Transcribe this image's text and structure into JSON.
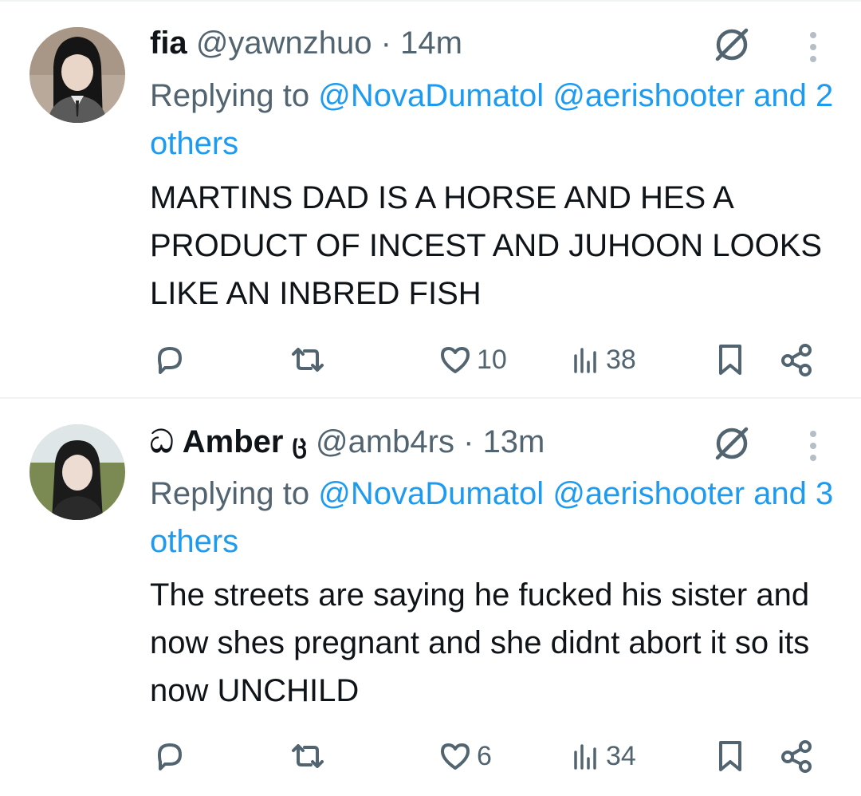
{
  "tweets": [
    {
      "display_name": "fia",
      "handle": "@yawnzhuo",
      "separator": "·",
      "time": "14m",
      "reply_prefix": "Replying to",
      "mentions": [
        "@NovaDumatol",
        "@aerishooter"
      ],
      "others": "and 2 others",
      "text": "MARTINS DAD IS A HORSE AND HES A PRODUCT OF INCEST AND JUHOON LOOKS LIKE AN INBRED FISH",
      "likes": "10",
      "views": "38"
    },
    {
      "name_prefix_glyph": "ධ",
      "display_name": "Amber",
      "name_suffix_glyph": "ც",
      "handle": "@amb4rs",
      "separator": "·",
      "time": "13m",
      "reply_prefix": "Replying to",
      "mentions": [
        "@NovaDumatol",
        "@aerishooter"
      ],
      "others": "and 3 others",
      "text": "The streets are saying he fucked his sister and now shes pregnant and she didnt abort it so its now UNCHILD",
      "likes": "6",
      "views": "34"
    }
  ],
  "icons": {
    "reply": "reply-icon",
    "repost": "repost-icon",
    "like": "heart-icon",
    "views": "views-icon",
    "bookmark": "bookmark-icon",
    "share": "share-icon",
    "grok": "grok-icon",
    "more": "more-vertical-icon"
  },
  "colors": {
    "text": "#0f1419",
    "secondary": "#536471",
    "link": "#1d9bf0",
    "divider": "#eff3f4"
  }
}
